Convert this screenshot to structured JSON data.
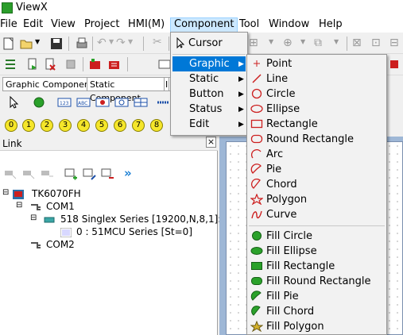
{
  "window": {
    "title": "ViewX"
  },
  "menubar": [
    "File",
    "Edit",
    "View",
    "Project",
    "HMI(M)",
    "Component",
    "Tool",
    "Window",
    "Help"
  ],
  "tabs": [
    "Graphic Component",
    "Static Component",
    "I"
  ],
  "number_buttons": [
    "0",
    "1",
    "2",
    "3",
    "4",
    "5",
    "6",
    "7",
    "8"
  ],
  "link_panel": {
    "title": "Link",
    "close": "×",
    "tree": [
      {
        "label": "TK6070FH",
        "toggle": "⊟"
      },
      {
        "label": "COM1",
        "toggle": "⊟"
      },
      {
        "label": "518 Singlex Series [19200,N,8,1]:",
        "toggle": "⊟"
      },
      {
        "label": "0 : 51MCU Series [St=0]",
        "toggle": ""
      },
      {
        "label": "COM2",
        "toggle": ""
      }
    ]
  },
  "component_menu": {
    "items": [
      "Cursor",
      "Graphic",
      "Static",
      "Button",
      "Status",
      "Edit"
    ],
    "highlighted": "Graphic"
  },
  "graphic_submenu": {
    "shapes": [
      "Point",
      "Line",
      "Circle",
      "Ellipse",
      "Rectangle",
      "Round Rectangle",
      "Arc",
      "Pie",
      "Chord",
      "Polygon",
      "Curve"
    ],
    "fills": [
      "Fill Circle",
      "Fill Ellipse",
      "Fill Rectangle",
      "Fill Round Rectangle",
      "Fill Pie",
      "Fill Chord",
      "Fill Polygon"
    ]
  },
  "colors": {
    "highlight": "#0078d7",
    "icon_red": "#cc1f1f",
    "icon_green": "#2aa12a",
    "number_yellow": "#f5e62a"
  }
}
